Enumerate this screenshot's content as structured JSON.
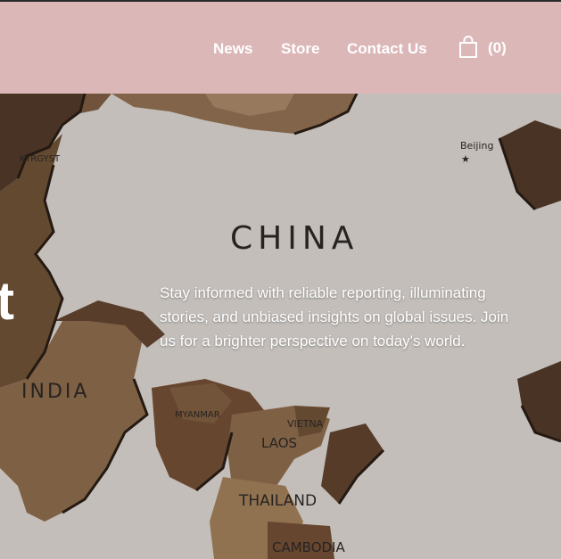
{
  "nav": {
    "items": [
      {
        "label": "News"
      },
      {
        "label": "Store"
      },
      {
        "label": "Contact Us"
      }
    ],
    "cart": {
      "icon": "shopping-bag-icon",
      "count_label": "(0)"
    }
  },
  "hero": {
    "heading_fragment": "t",
    "description": "Stay informed with reliable reporting, illuminating stories, and unbiased insights on global issues. Join us for a brighter perspective on today's world.",
    "map_labels": {
      "china": "CHINA",
      "india": "INDIA",
      "beijing": "Beijing",
      "laos": "LAOS",
      "thailand": "THAILAND",
      "cambodia": "CAMBODIA",
      "vietnam": "VIETNA",
      "kyrgyz": "KYRGYST",
      "myanmar": "MYANMAR"
    }
  },
  "colors": {
    "header_bg": "#dcb7b8",
    "nav_text": "#ffffff"
  }
}
